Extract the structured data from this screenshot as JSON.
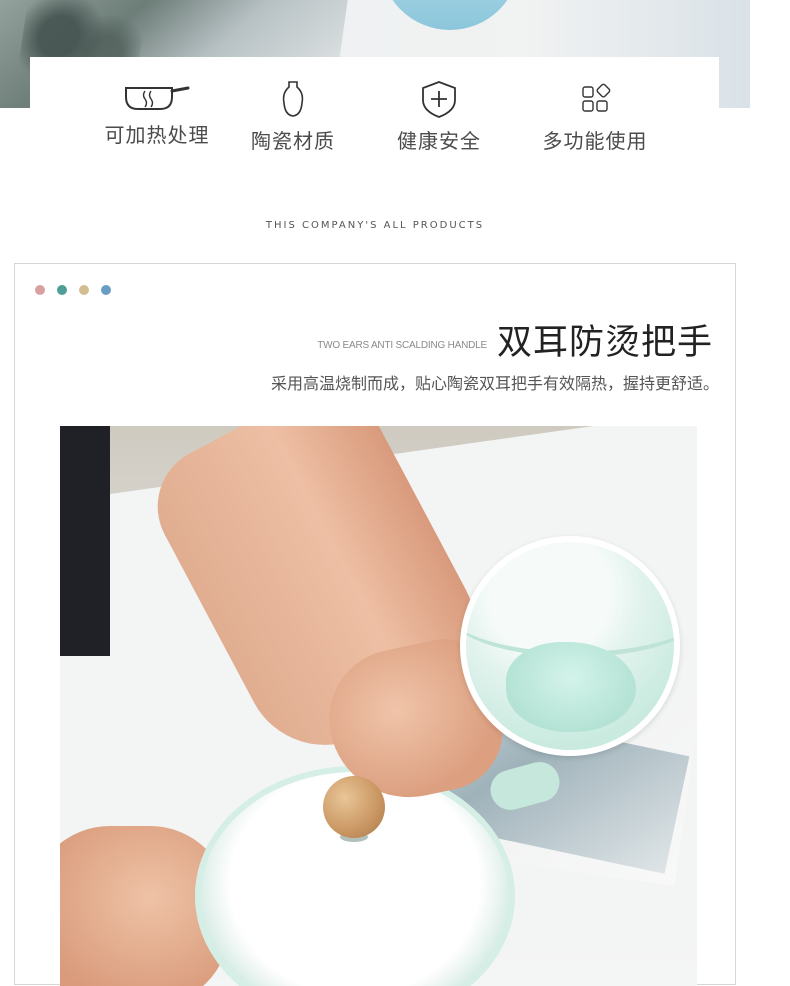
{
  "features": [
    {
      "icon": "pot-steam-icon",
      "label": "可加热处理"
    },
    {
      "icon": "vase-icon",
      "label": "陶瓷材质"
    },
    {
      "icon": "shield-cross-icon",
      "label": "健康安全"
    },
    {
      "icon": "grid-diamond-icon",
      "label": "多功能使用"
    }
  ],
  "section": {
    "tagline": "THIS COMPANY'S ALL PRODUCTS"
  },
  "product": {
    "dots": [
      "#d9a0a0",
      "#4f9e98",
      "#d1bd91",
      "#6a9dc4"
    ],
    "title_en": "TWO EARS ANTI SCALDING HANDLE",
    "title": "双耳防烫把手",
    "description": "采用高温烧制而成，贴心陶瓷双耳把手有效隔热，握持更舒适。"
  },
  "colors": {
    "text": "#4b4b4b",
    "border": "#d6d6d6",
    "pot_green": "#c6e8dc"
  }
}
